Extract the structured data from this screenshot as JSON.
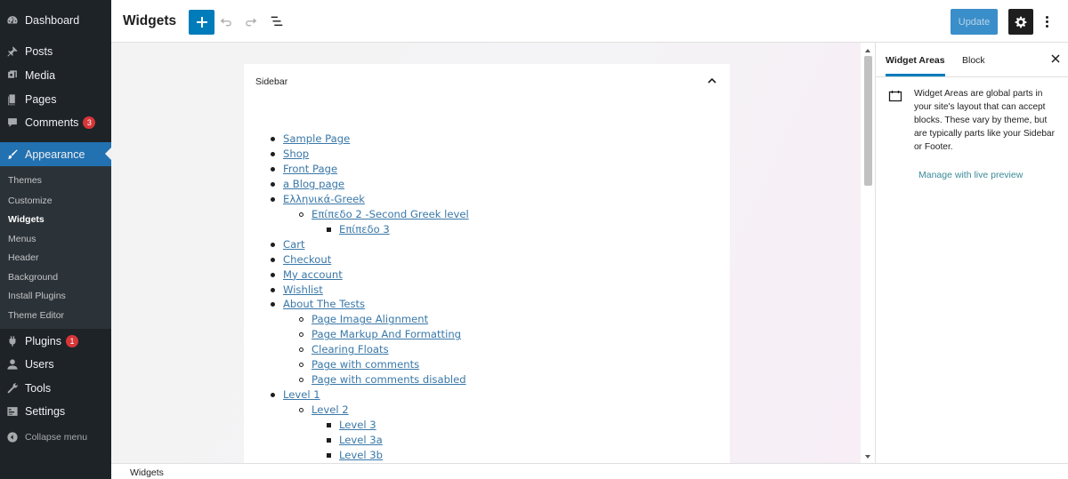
{
  "admin_menu": {
    "items": [
      {
        "label": "Dashboard",
        "icon": "dashboard-icon"
      },
      {
        "label": "Posts",
        "icon": "pin-icon"
      },
      {
        "label": "Media",
        "icon": "media-icon"
      },
      {
        "label": "Pages",
        "icon": "pages-icon"
      },
      {
        "label": "Comments",
        "icon": "comment-icon",
        "badge": "3"
      },
      {
        "label": "Appearance",
        "icon": "brush-icon"
      },
      {
        "label": "Plugins",
        "icon": "plugin-icon",
        "badge": "1"
      },
      {
        "label": "Users",
        "icon": "user-icon"
      },
      {
        "label": "Tools",
        "icon": "wrench-icon"
      },
      {
        "label": "Settings",
        "icon": "settings-icon"
      },
      {
        "label": "Collapse menu",
        "icon": "collapse-icon"
      }
    ],
    "submenu": [
      "Themes",
      "Customize",
      "Widgets",
      "Menus",
      "Header",
      "Background",
      "Install Plugins",
      "Theme Editor"
    ]
  },
  "header": {
    "title": "Widgets",
    "update_label": "Update"
  },
  "widget_area": {
    "title": "Sidebar",
    "pages": [
      {
        "label": "Sample Page",
        "level": 1
      },
      {
        "label": "Shop",
        "level": 1
      },
      {
        "label": "Front Page",
        "level": 1
      },
      {
        "label": "a Blog page",
        "level": 1
      },
      {
        "label": "Ελληνικά-Greek",
        "level": 1
      },
      {
        "label": "Επίπεδο 2 -Second Greek level",
        "level": 2
      },
      {
        "label": "Επίπεδο 3",
        "level": 3
      },
      {
        "label": "Cart",
        "level": 1
      },
      {
        "label": "Checkout",
        "level": 1
      },
      {
        "label": "My account",
        "level": 1
      },
      {
        "label": "Wishlist",
        "level": 1
      },
      {
        "label": "About The Tests",
        "level": 1
      },
      {
        "label": "Page Image Alignment",
        "level": 2
      },
      {
        "label": "Page Markup And Formatting",
        "level": 2
      },
      {
        "label": "Clearing Floats",
        "level": 2
      },
      {
        "label": "Page with comments",
        "level": 2
      },
      {
        "label": "Page with comments disabled",
        "level": 2
      },
      {
        "label": "Level 1",
        "level": 1
      },
      {
        "label": "Level 2",
        "level": 2
      },
      {
        "label": "Level 3",
        "level": 3
      },
      {
        "label": "Level 3a",
        "level": 3
      },
      {
        "label": "Level 3b",
        "level": 3
      }
    ]
  },
  "inspector": {
    "tab_widget_areas": "Widget Areas",
    "tab_block": "Block",
    "description": "Widget Areas are global parts in your site's layout that can accept blocks. These vary by theme, but are typically parts like your Sidebar or Footer.",
    "link": "Manage with live preview"
  },
  "footer": {
    "breadcrumb": "Widgets"
  },
  "colors": {
    "admin_bg": "#1d2327",
    "accent": "#007cba",
    "active_menu": "#2271b1",
    "link": "#3a78a8",
    "badge": "#d63638"
  }
}
